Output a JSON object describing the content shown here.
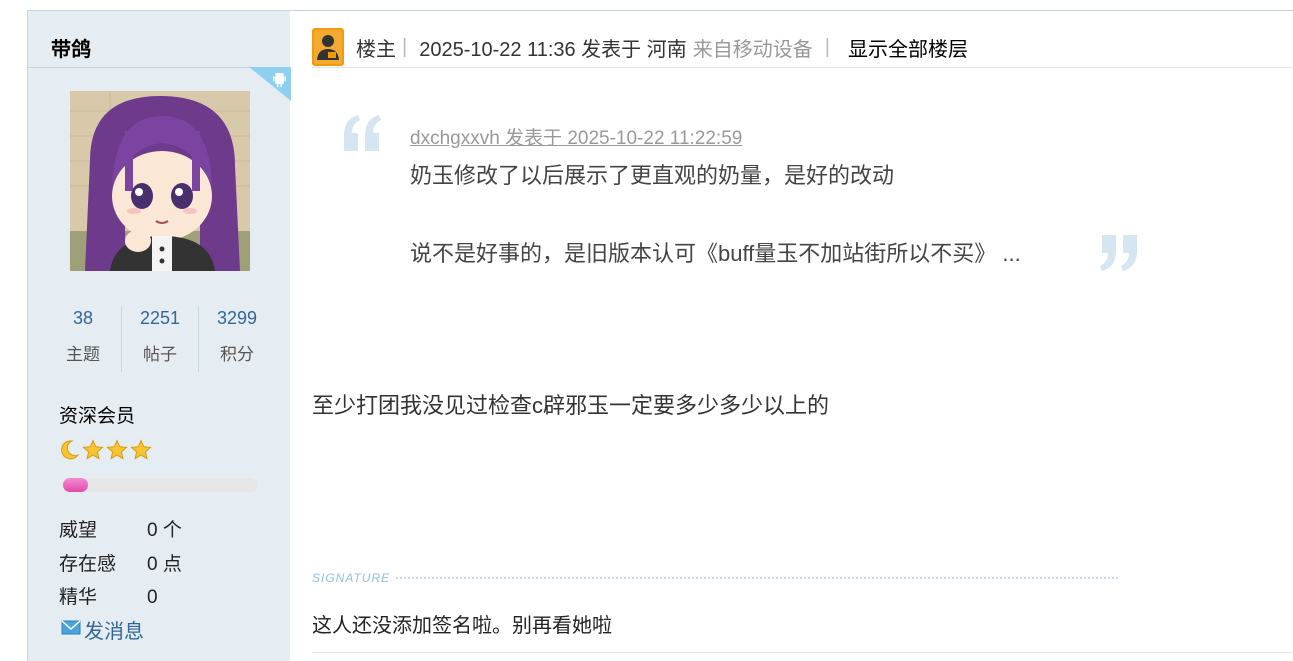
{
  "author": {
    "name": "带鸽",
    "stats": [
      {
        "value": "38",
        "label": "主题"
      },
      {
        "value": "2251",
        "label": "帖子"
      },
      {
        "value": "3299",
        "label": "积分"
      }
    ],
    "rank_title": "资深会员",
    "rank_icons": [
      "moon-icon",
      "star-icon",
      "star-icon",
      "star-icon"
    ],
    "level_progress": 0.13,
    "info": [
      {
        "label": "威望",
        "value": "0 个"
      },
      {
        "label": "存在感",
        "value": "0 点"
      },
      {
        "label": "精华",
        "value": "0"
      }
    ],
    "message_label": "发消息"
  },
  "post": {
    "role": "楼主",
    "time": "2025-10-22 11:36 发表于 河南",
    "from": "来自移动设备",
    "show_all": "显示全部楼层",
    "quote": {
      "meta": "dxchgxxvh 发表于 2025-10-22 11:22:59",
      "line1": "奶玉修改了以后展示了更直观的奶量，是好的改动",
      "line2": "说不是好事的，是旧版本认可《buff量玉不加站街所以不买》 ..."
    },
    "body": "至少打团我没见过检查c辟邪玉一定要多少多少以上的",
    "signature_label": "SIGNATURE",
    "signature": "这人还没添加签名啦。别再看她啦"
  },
  "colors": {
    "sidebar_bg": "#e5edf2",
    "link": "#336699",
    "progress_fill": "#e34aa8",
    "mobile_badge": "#8fd0f0"
  }
}
